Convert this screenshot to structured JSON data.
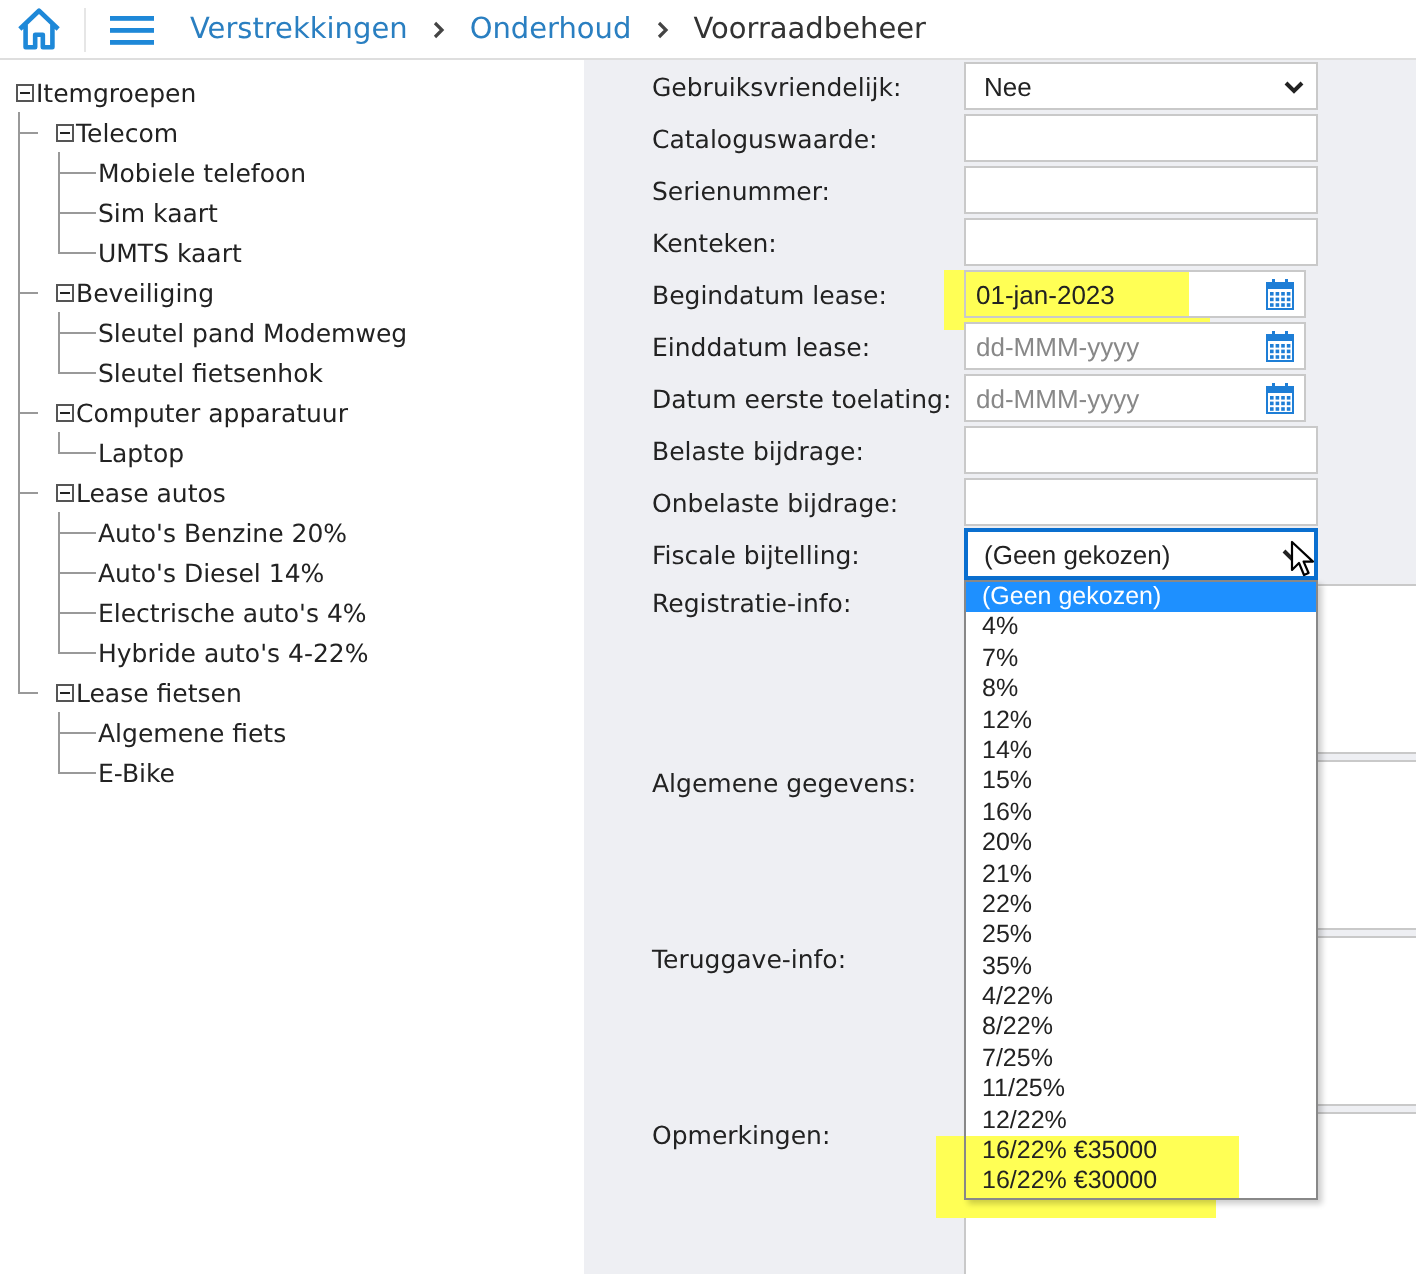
{
  "breadcrumbs": [
    {
      "label": "Verstrekkingen",
      "kind": "link"
    },
    {
      "label": "Onderhoud",
      "kind": "link"
    },
    {
      "label": "Voorraadbeheer",
      "kind": "current"
    }
  ],
  "tree": {
    "label": "Itemgroepen",
    "expanded": true,
    "children": [
      {
        "label": "Telecom",
        "expanded": true,
        "children": [
          {
            "label": "Mobiele telefoon"
          },
          {
            "label": "Sim kaart"
          },
          {
            "label": "UMTS kaart"
          }
        ]
      },
      {
        "label": "Beveiliging",
        "expanded": true,
        "children": [
          {
            "label": "Sleutel pand Modemweg"
          },
          {
            "label": "Sleutel fietsenhok"
          }
        ]
      },
      {
        "label": "Computer apparatuur",
        "expanded": true,
        "children": [
          {
            "label": "Laptop"
          }
        ]
      },
      {
        "label": "Lease autos",
        "expanded": true,
        "children": [
          {
            "label": "Auto's Benzine 20%"
          },
          {
            "label": "Auto's Diesel 14%"
          },
          {
            "label": "Electrische auto's 4%"
          },
          {
            "label": "Hybride auto's 4-22%"
          }
        ]
      },
      {
        "label": "Lease fietsen",
        "expanded": true,
        "children": [
          {
            "label": "Algemene fiets"
          },
          {
            "label": "E-Bike"
          }
        ]
      }
    ]
  },
  "form": {
    "fields": [
      {
        "label": "Gebruiksvriendelijk:",
        "kind": "select",
        "value": "Nee",
        "open": false
      },
      {
        "label": "Cataloguswaarde:",
        "kind": "text"
      },
      {
        "label": "Serienummer:",
        "kind": "text"
      },
      {
        "label": "Kenteken:",
        "kind": "text"
      },
      {
        "label": "Begindatum lease:",
        "kind": "date",
        "value": "01-jan-2023",
        "highlighted": true
      },
      {
        "label": "Einddatum lease:",
        "kind": "date",
        "placeholder": "dd-MMM-yyyy"
      },
      {
        "label": "Datum eerste toelating:",
        "kind": "date",
        "placeholder": "dd-MMM-yyyy"
      },
      {
        "label": "Belaste bijdrage:",
        "kind": "text"
      },
      {
        "label": "Onbelaste bijdrage:",
        "kind": "text"
      },
      {
        "label": "Fiscale bijtelling:",
        "kind": "select",
        "value": "(Geen gekozen)",
        "open": true,
        "options": [
          {
            "label": "(Geen gekozen)",
            "selected": true
          },
          {
            "label": "4%",
            "selected": false
          },
          {
            "label": "7%",
            "selected": false
          },
          {
            "label": "8%",
            "selected": false
          },
          {
            "label": "12%",
            "selected": false
          },
          {
            "label": "14%",
            "selected": false
          },
          {
            "label": "15%",
            "selected": false
          },
          {
            "label": "16%",
            "selected": false
          },
          {
            "label": "20%",
            "selected": false
          },
          {
            "label": "21%",
            "selected": false
          },
          {
            "label": "22%",
            "selected": false
          },
          {
            "label": "25%",
            "selected": false
          },
          {
            "label": "35%",
            "selected": false
          },
          {
            "label": "4/22%",
            "selected": false
          },
          {
            "label": "8/22%",
            "selected": false
          },
          {
            "label": "7/25%",
            "selected": false
          },
          {
            "label": "11/25%",
            "selected": false
          },
          {
            "label": "12/22%",
            "selected": false
          },
          {
            "label": "16/22% €35000",
            "selected": false,
            "highlighted": true
          },
          {
            "label": "16/22% €30000",
            "selected": false,
            "highlighted": true
          }
        ]
      },
      {
        "label": "Registratie-info:",
        "kind": "textarea"
      },
      {
        "label": "Algemene gegevens:",
        "kind": "textarea"
      },
      {
        "label": "Teruggave-info:",
        "kind": "textarea"
      },
      {
        "label": "Opmerkingen:",
        "kind": "textarea"
      }
    ]
  }
}
